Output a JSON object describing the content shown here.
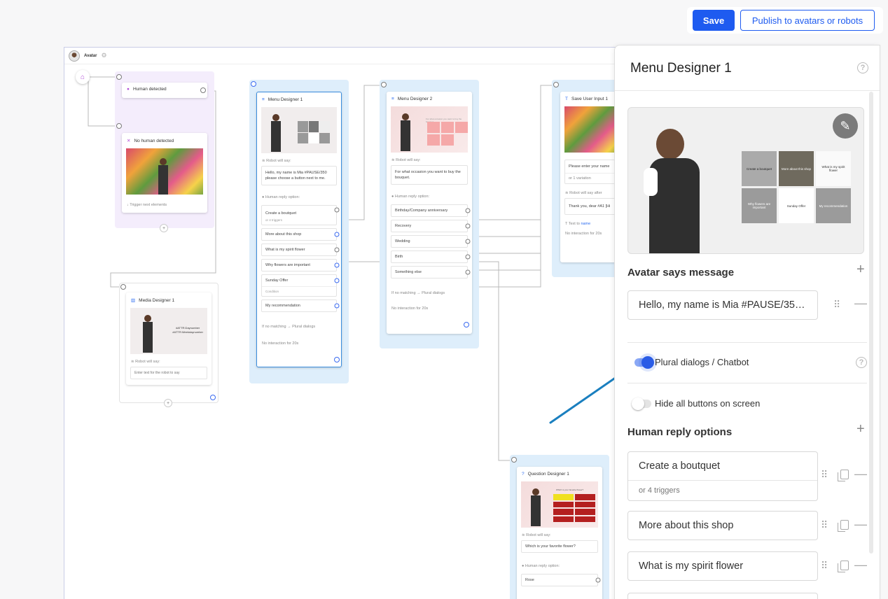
{
  "toolbar": {
    "save_label": "Save",
    "publish_label": "Publish to avatars or robots"
  },
  "canvas": {
    "header": {
      "title": "Avatar"
    },
    "nodes": {
      "human_detected": {
        "title": "Human detected"
      },
      "no_human_detected": {
        "title": "No human detected",
        "footer": "Trigger next elements"
      },
      "media_designer": {
        "title": "Media Designer 1",
        "robot_label": "Robot will say:",
        "input_placeholder": "Enter text for the robot to say",
        "overlay_line1": "#ATTR:Daynumber",
        "overlay_line2": "#ATTR:Weekdaynumber"
      },
      "menu1": {
        "title": "Menu Designer 1",
        "robot_label": "Robot will say:",
        "message": "Hello, my name is Mia #PAUSE/350 please choose a button next to me.",
        "reply_label": "Human reply option:",
        "options": [
          "Create a boutquet",
          "More about this shop",
          "What is my spirit flower",
          "Why flowers are important",
          "Sunday Offer",
          "My recommendation"
        ],
        "option0_sub": "or 4 triggers",
        "option4_sub": "Condition",
        "no_match": "If no matching → Plural dialogs",
        "no_interaction": "No interaction for 20s"
      },
      "menu2": {
        "title": "Menu Designer 2",
        "robot_label": "Robot will say:",
        "message": "For what occasion you want to buy the bouquet.",
        "reply_label": "Human reply option:",
        "options": [
          "Birthday/Company anniversary",
          "Recovery",
          "Wedding",
          "Birth",
          "Something else"
        ],
        "no_match": "If no matching → Plural dialogs",
        "no_interaction": "No interaction for 20s",
        "preview_heading": "For what occasion you want to buy the bouquet"
      },
      "save_input": {
        "title": "Save User Input 1",
        "message": "Please enter your name",
        "variation": "or 1 variation",
        "robot_after": "Robot will say after",
        "thanks": "Thank you, dear #A1 [Hi",
        "text_to": "Text to",
        "text_to_link": "name",
        "no_interaction": "No interaction for 20s"
      },
      "question": {
        "title": "Question Designer 1",
        "robot_label": "Robot will say:",
        "message": "Which is your favorite flower?",
        "reply_label": "Human reply option:",
        "first_option": "Rose",
        "preview_heading": "Which is your favorite flower?"
      }
    }
  },
  "panel": {
    "title": "Menu Designer 1",
    "preview_tiles": [
      "Create a boutquet",
      "More about this shop",
      "What is my spirit flower",
      "Why flowers are important",
      "Sunday Offer",
      "My recommendation"
    ],
    "avatar_says": {
      "title": "Avatar says message",
      "message": "Hello, my name is Mia #PAUSE/350 please choose a button next to me."
    },
    "plural_dialogs": {
      "label": "Plural dialogs / Chatbot",
      "enabled": true
    },
    "hide_buttons": {
      "label": "Hide all buttons on screen",
      "enabled": false
    },
    "human_reply": {
      "title": "Human reply options",
      "options": [
        {
          "label": "Create a boutquet",
          "sub": "or 4 triggers"
        },
        {
          "label": "More about this shop"
        },
        {
          "label": "What is my spirit flower"
        }
      ]
    }
  },
  "colors": {
    "accent": "#1e5bf0",
    "arrow": "#1a7fbf",
    "group_purple": "#f4edfc",
    "group_blue": "#deeefb"
  }
}
